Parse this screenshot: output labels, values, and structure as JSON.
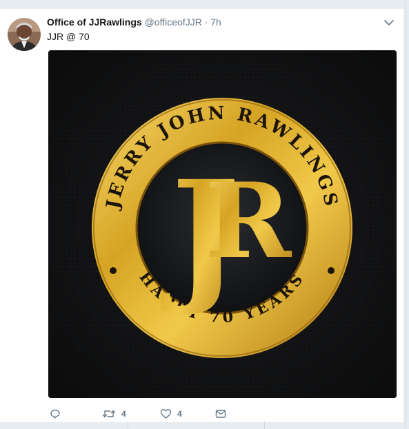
{
  "tweet": {
    "display_name": "Office of JJRawlings",
    "handle": "@officeofJJR",
    "separator": "·",
    "time": "7h",
    "text": "JJR @ 70"
  },
  "media": {
    "logo_top_text": "JERRY JOHN RAWLINGS",
    "logo_bottom_text": "HAPPY 70 YEARS",
    "logo_monogram_left": "J",
    "logo_monogram_right": "R"
  },
  "actions": {
    "reply_icon": "reply-icon",
    "retweet_icon": "retweet-icon",
    "retweet_count": "4",
    "like_icon": "heart-icon",
    "like_count": "4",
    "dm_icon": "envelope-icon"
  },
  "colors": {
    "text_primary": "#14171a",
    "text_secondary": "#657786",
    "gold": "#d4a21e",
    "media_bg": "#161718"
  }
}
